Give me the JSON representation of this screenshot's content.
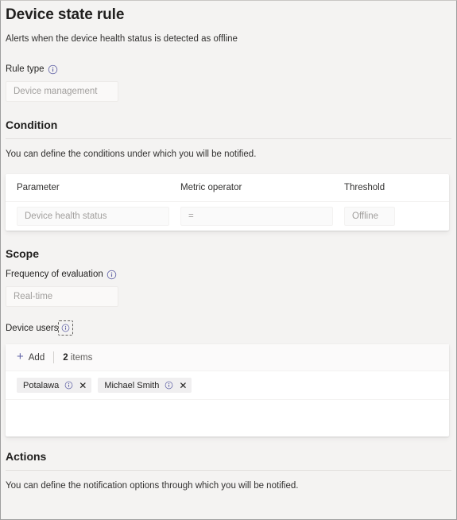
{
  "header": {
    "title": "Device state rule",
    "subtitle": "Alerts when the device health status is detected as offline"
  },
  "rule_type": {
    "label": "Rule type",
    "info_icon": "info-circle-icon",
    "value": "Device management"
  },
  "condition": {
    "heading": "Condition",
    "description": "You can define the conditions under which you will be notified.",
    "columns": [
      "Parameter",
      "Metric operator",
      "Threshold"
    ],
    "rows": [
      {
        "parameter": "Device health status",
        "metric_operator": "=",
        "threshold": "Offline"
      }
    ]
  },
  "scope": {
    "heading": "Scope",
    "frequency": {
      "label": "Frequency of evaluation",
      "info_icon": "info-circle-icon",
      "value": "Real-time"
    },
    "device_users": {
      "label": "Device users",
      "info_icon": "info-circle-icon",
      "toolbar": {
        "add_label": "Add",
        "add_icon": "plus-icon",
        "count": "2",
        "count_word": "items"
      },
      "chips": [
        {
          "name": "Potalawa",
          "info_icon": "info-circle-icon",
          "remove_icon": "close-icon"
        },
        {
          "name": "Michael Smith",
          "info_icon": "info-circle-icon",
          "remove_icon": "close-icon"
        }
      ]
    }
  },
  "actions": {
    "heading": "Actions",
    "description": "You can define the notification options through which you will be notified."
  },
  "colors": {
    "accent": "#6264a7",
    "page_background": "#f4f3f2",
    "card_background": "#ffffff",
    "text_primary": "#252423",
    "text_disabled": "#a19f9d",
    "divider": "#e1dfdd"
  }
}
